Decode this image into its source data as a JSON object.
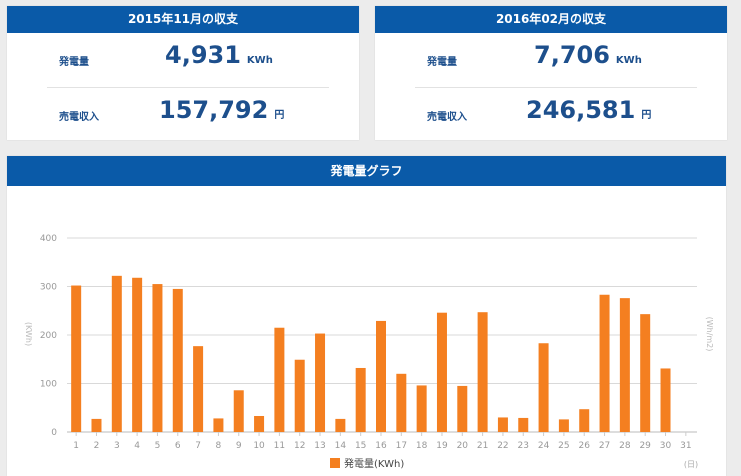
{
  "summary_cards": [
    {
      "title": "2015年11月の収支",
      "generation_label": "発電量",
      "generation_value": "4,931",
      "generation_unit": "KWh",
      "revenue_label": "売電収入",
      "revenue_value": "157,792",
      "revenue_unit": "円"
    },
    {
      "title": "2016年02月の収支",
      "generation_label": "発電量",
      "generation_value": "7,706",
      "generation_unit": "KWh",
      "revenue_label": "売電収入",
      "revenue_value": "246,581",
      "revenue_unit": "円"
    }
  ],
  "graph_panel": {
    "title": "発電量グラフ"
  },
  "colors": {
    "header_blue": "#0a5aa8",
    "bar_orange": "#f47f20",
    "value_blue": "#1d4f8c"
  },
  "chart_data": {
    "type": "bar",
    "categories": [
      "1",
      "2",
      "3",
      "4",
      "5",
      "6",
      "7",
      "8",
      "9",
      "10",
      "11",
      "12",
      "13",
      "14",
      "15",
      "16",
      "17",
      "18",
      "19",
      "20",
      "21",
      "22",
      "23",
      "24",
      "25",
      "26",
      "27",
      "28",
      "29",
      "30",
      "31"
    ],
    "series": [
      {
        "name": "発電量(KWh)",
        "values": [
          302,
          27,
          322,
          318,
          305,
          295,
          177,
          28,
          86,
          33,
          215,
          149,
          203,
          27,
          132,
          229,
          120,
          96,
          246,
          95,
          247,
          30,
          29,
          183,
          26,
          47,
          283,
          276,
          243,
          131,
          0
        ]
      }
    ],
    "ylim": [
      0,
      400
    ],
    "yticks": [
      "0",
      "100",
      "200",
      "300",
      "400"
    ],
    "ylabel": "(KWh)",
    "y2label": "(Wh/m2)",
    "xunit": "(日)",
    "grid": true,
    "legend_position": "bottom"
  }
}
